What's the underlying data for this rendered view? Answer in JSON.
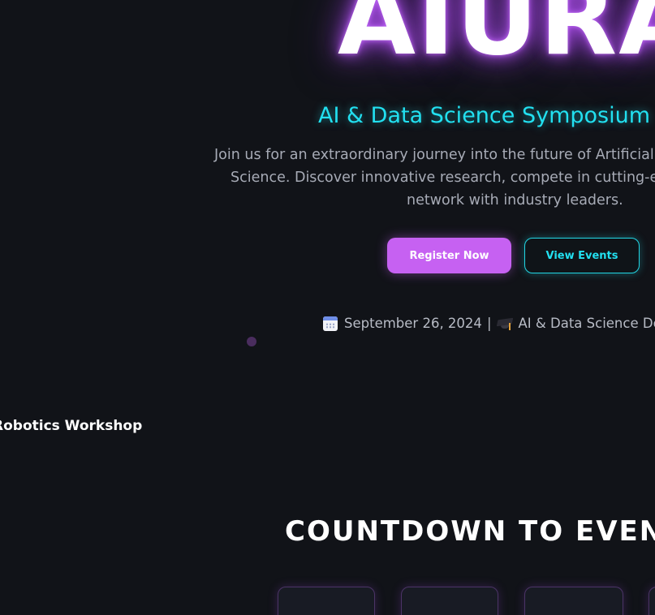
{
  "hero": {
    "title": "AIURA",
    "subtitle": "AI & Data Science Symposium",
    "description_lines": [
      "Join us for an extraordinary journey into the future of Artificial",
      "Science. Discover innovative research, compete in cutting-e",
      "network with industry leaders."
    ],
    "buttons": {
      "register_label": "Register Now",
      "view_events_label": "View Events"
    },
    "event_info": {
      "date": "September 26, 2024",
      "separator": "|",
      "department": "AI & Data Science Dep",
      "date_icon": "calendar-icon",
      "department_icon": "graduation-cap-icon"
    }
  },
  "floating_label": "Robotics Workshop",
  "countdown": {
    "heading": "COUNTDOWN TO EVENTS"
  },
  "colors": {
    "background": "#111318",
    "accent_purple": "#c661f2",
    "accent_cyan": "#22e0f0",
    "text_muted": "#a7abb6"
  }
}
